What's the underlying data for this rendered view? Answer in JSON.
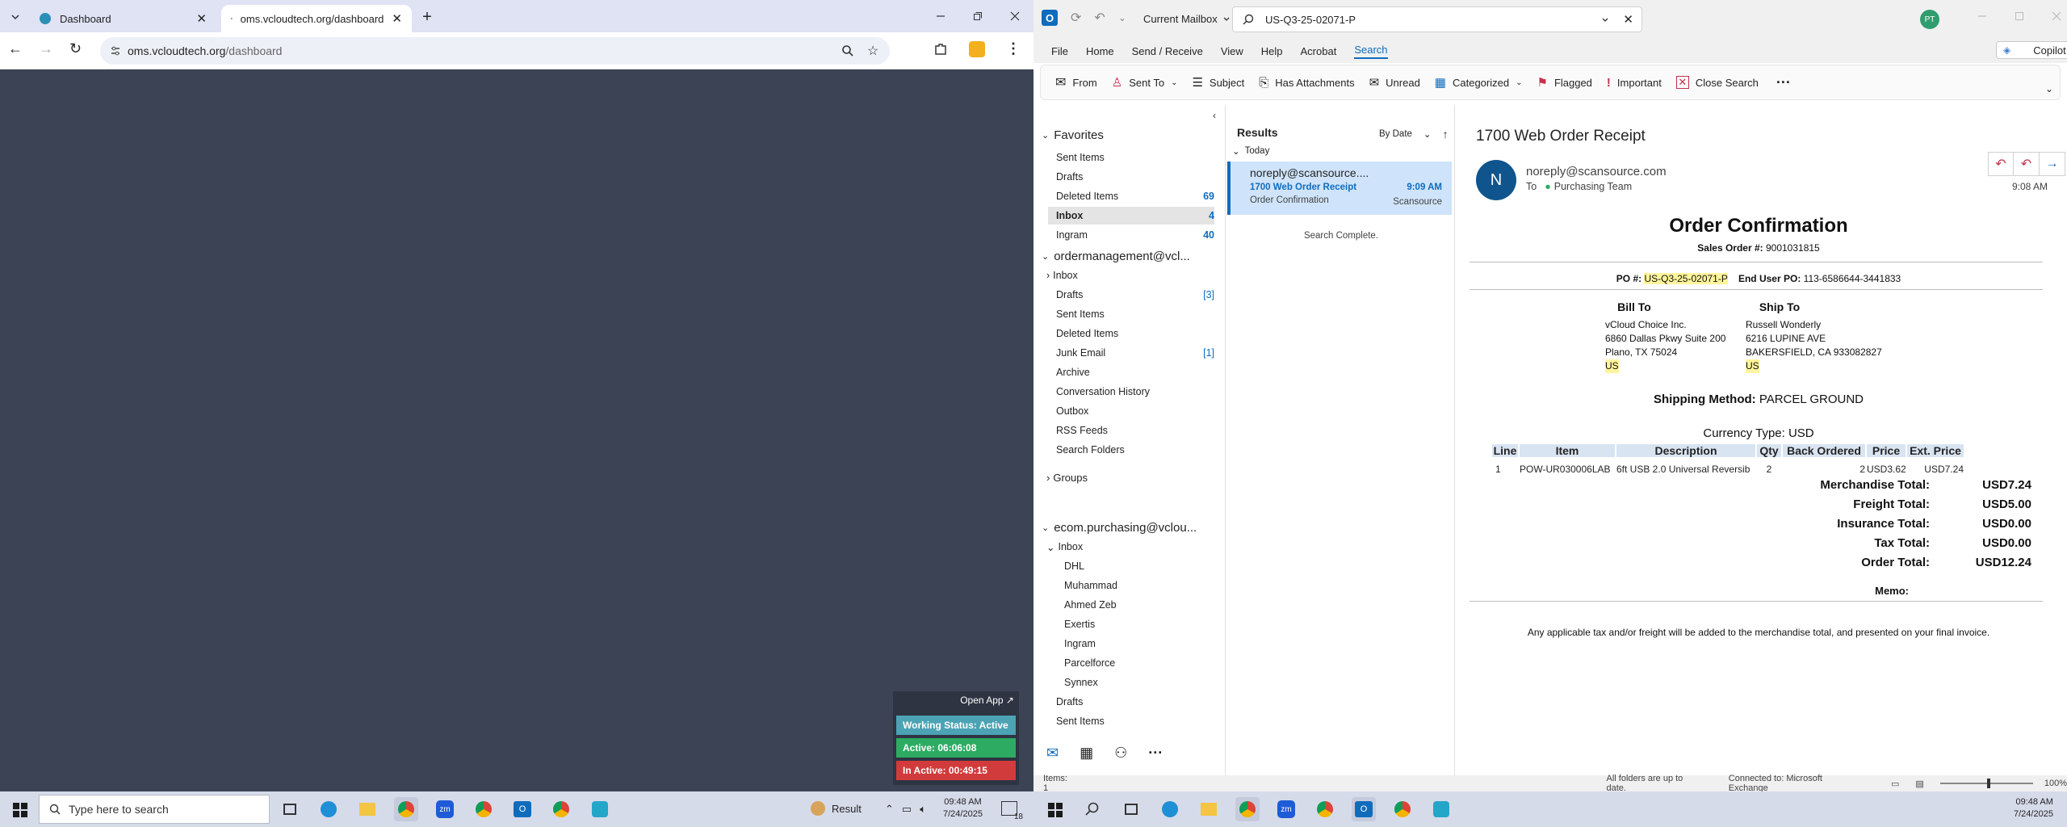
{
  "chrome": {
    "tabs": [
      {
        "label": "Dashboard"
      },
      {
        "label": "oms.vcloudtech.org/dashboard"
      }
    ],
    "url_host": "oms.vcloudtech.org",
    "url_path": "/dashboard"
  },
  "widget": {
    "open_app": "Open App ↗",
    "working_status": "Working Status: Active",
    "active": "Active: 06:06:08",
    "inactive": "In Active: 00:49:15"
  },
  "outlook": {
    "mailbox_scope": "Current Mailbox",
    "search_query": "US-Q3-25-02071-P",
    "avatar_initials": "PT",
    "copilot": "Copilot",
    "menu": [
      "File",
      "Home",
      "Send / Receive",
      "View",
      "Help",
      "Acrobat",
      "Search"
    ],
    "ribbon": [
      "From",
      "Sent To",
      "Subject",
      "Has Attachments",
      "Unread",
      "Categorized",
      "Flagged",
      "Important",
      "Close Search"
    ],
    "favorites": {
      "title": "Favorites",
      "items": [
        {
          "label": "Sent Items",
          "count": ""
        },
        {
          "label": "Drafts",
          "count": ""
        },
        {
          "label": "Deleted Items",
          "count": "69"
        },
        {
          "label": "Inbox",
          "count": "4"
        },
        {
          "label": "Ingram",
          "count": "40"
        }
      ]
    },
    "account1": {
      "title": "ordermanagement@vcl...",
      "items": [
        {
          "label": "Inbox",
          "count": ""
        },
        {
          "label": "Drafts",
          "count": "[3]"
        },
        {
          "label": "Sent Items",
          "count": ""
        },
        {
          "label": "Deleted Items",
          "count": ""
        },
        {
          "label": "Junk Email",
          "count": "[1]"
        },
        {
          "label": "Archive",
          "count": ""
        },
        {
          "label": "Conversation History",
          "count": ""
        },
        {
          "label": "Outbox",
          "count": ""
        },
        {
          "label": "RSS Feeds",
          "count": ""
        },
        {
          "label": "Search Folders",
          "count": ""
        }
      ]
    },
    "groups": "Groups",
    "account2": {
      "title": "ecom.purchasing@vclou...",
      "inbox": "Inbox",
      "subfolders": [
        "DHL",
        "Muhammad",
        "Ahmed Zeb",
        "Exertis",
        "Ingram",
        "Parcelforce",
        "Synnex"
      ],
      "items": [
        "Drafts",
        "Sent Items"
      ]
    },
    "results": {
      "title": "Results",
      "sort": "By Date",
      "group": "Today",
      "message": {
        "from": "noreply@scansource....",
        "subject": "1700 Web Order Receipt",
        "preview": "Order Confirmation",
        "time": "9:09 AM",
        "folder": "Scansource"
      },
      "status": "Search Complete."
    },
    "reading": {
      "subject": "1700 Web Order Receipt",
      "sender_initial": "N",
      "sender": "noreply@scansource.com",
      "to_label": "To",
      "to": "Purchasing Team",
      "time": "9:08 AM",
      "doc": {
        "title": "Order Confirmation",
        "sales_order_label": "Sales Order #:",
        "sales_order": "9001031815",
        "po_label": "PO #:",
        "po": "US-Q3-25-02071-P",
        "end_user_po_label": "End User PO:",
        "end_user_po": "113-6586644-3441833",
        "bill_to_label": "Bill To",
        "bill_to": [
          "vCloud Choice Inc.",
          "6860 Dallas Pkwy Suite 200",
          "Plano, TX 75024",
          "US"
        ],
        "ship_to_label": "Ship To",
        "ship_to": [
          "Russell Wonderly",
          "6216 LUPINE AVE",
          "BAKERSFIELD, CA 933082827",
          "US"
        ],
        "shipping_label": "Shipping Method:",
        "shipping": "PARCEL GROUND",
        "currency_label": "Currency Type:",
        "currency": "USD",
        "columns": [
          "Line",
          "Item",
          "Description",
          "Qty",
          "Back Ordered",
          "Price",
          "Ext. Price"
        ],
        "rows": [
          [
            "1",
            "POW-UR030006LAB",
            "6ft USB 2.0 Universal Reversib",
            "2",
            "2",
            "USD3.62",
            "USD7.24"
          ]
        ],
        "totals": [
          {
            "label": "Merchandise Total:",
            "value": "USD7.24"
          },
          {
            "label": "Freight Total:",
            "value": "USD5.00"
          },
          {
            "label": "Insurance Total:",
            "value": "USD0.00"
          },
          {
            "label": "Tax Total:",
            "value": "USD0.00"
          },
          {
            "label": "Order Total:",
            "value": "USD12.24"
          }
        ],
        "memo_label": "Memo:",
        "footer": "Any applicable tax and/or freight will be added to the merchandise total, and presented on your final invoice."
      }
    },
    "status": {
      "items": "Items: 1",
      "sync": "All folders are up to date.",
      "connection": "Connected to: Microsoft Exchange",
      "zoom": "100%"
    }
  },
  "taskbar_left": {
    "search_placeholder": "Type here to search",
    "result": "Result",
    "time": "09:48 AM",
    "date": "7/24/2025",
    "badge": "18"
  },
  "taskbar_right": {
    "time": "09:48 AM",
    "date": "7/24/2025"
  }
}
